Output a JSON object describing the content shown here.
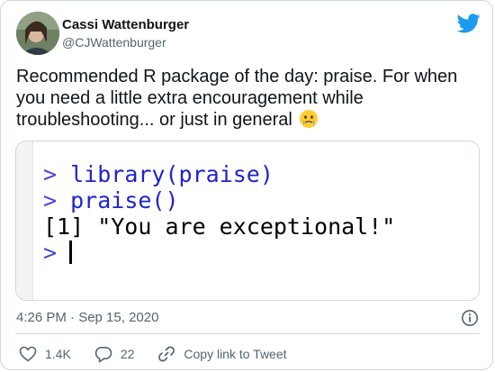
{
  "tweet": {
    "author_name": "Cassi Wattenburger",
    "author_handle": "@CJWattenburger",
    "text": "Recommended R package of the day: praise. For when you need a little extra encouragement while troubleshooting... or just in general",
    "emoji": "face-holding-back-tears",
    "timestamp": "4:26 PM · Sep 15, 2020",
    "likes": "1.4K",
    "replies": "22",
    "copy_link_label": "Copy link to Tweet"
  },
  "console": {
    "lines": [
      {
        "prompt": ">",
        "text": "library(praise)"
      },
      {
        "prompt": ">",
        "text": "praise()"
      },
      {
        "prompt": "",
        "text": "[1] \"You are exceptional!\""
      },
      {
        "prompt": ">",
        "text": ""
      }
    ]
  },
  "colors": {
    "twitter_blue": "#1d9bf0",
    "text_secondary": "#536471",
    "console_command": "#1f24c9"
  },
  "icons": {
    "brand": "twitter-bird-icon",
    "info": "info-icon",
    "like": "heart-icon",
    "reply": "reply-bubble-icon",
    "link": "link-icon"
  }
}
